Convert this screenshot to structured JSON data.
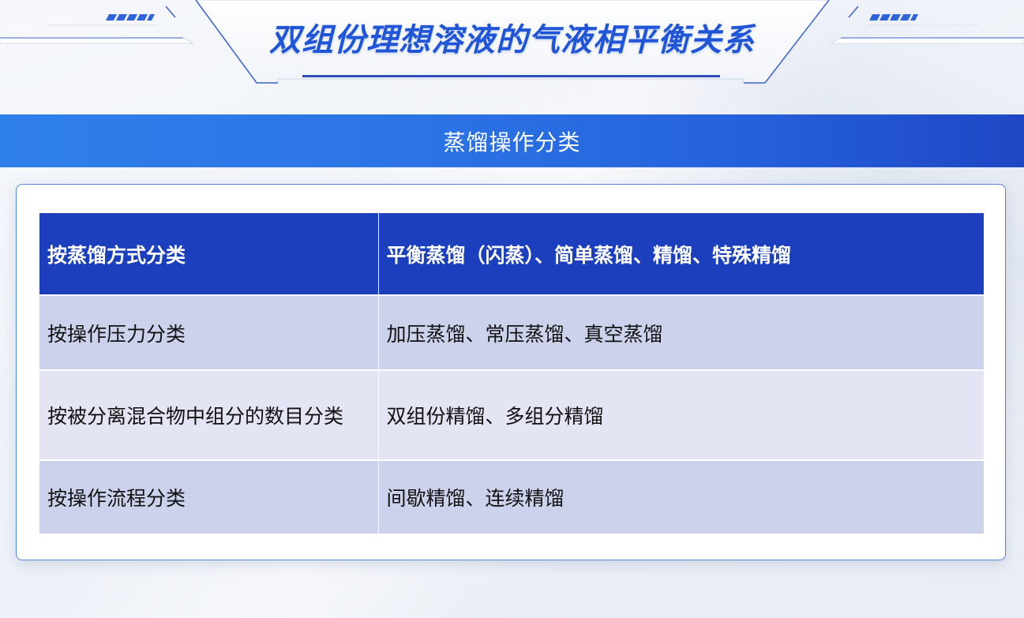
{
  "page": {
    "title": "双组份理想溶液的气液相平衡关系",
    "section_title": "蒸馏操作分类"
  },
  "table": {
    "header": {
      "category": "按蒸馏方式分类",
      "types": "平衡蒸馏（闪蒸）、简单蒸馏、精馏、特殊精馏"
    },
    "rows": [
      {
        "category": "按操作压力分类",
        "types": "加压蒸馏、常压蒸馏、真空蒸馏"
      },
      {
        "category": "按被分离混合物中组分的数目分类",
        "types": "双组份精馏、多组分精馏"
      },
      {
        "category": "按操作流程分类",
        "types": "间歇精馏、连续精馏"
      }
    ]
  },
  "colors": {
    "title": "#1f55d6",
    "banner": "#2c74e6",
    "table_header": "#1c3fbd",
    "row_dark": "#cdd2ec",
    "row_light": "#e3e5f5",
    "card_border": "#5b86dc"
  }
}
